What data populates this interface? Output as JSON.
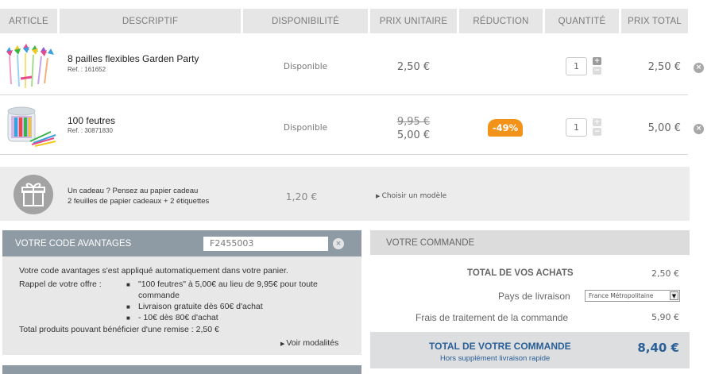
{
  "header": {
    "article": "ARTICLE",
    "descriptif": "DESCRIPTIF",
    "disponibilite": "DISPONIBILITÉ",
    "prix_unitaire": "PRIX UNITAIRE",
    "reduction": "RÉDUCTION",
    "quantite": "QUANTITÉ",
    "prix_total": "PRIX TOTAL"
  },
  "items": [
    {
      "name": "8 pailles flexibles Garden Party",
      "ref": "Ref. : 161652",
      "availability": "Disponible",
      "unit_price": "2,50 €",
      "quantity": "1",
      "total": "2,50 €",
      "thumb_icon": "straws-image"
    },
    {
      "name": "100 feutres",
      "ref": "Ref. : 30871830",
      "availability": "Disponible",
      "old_price": "9,95 €",
      "unit_price": "5,00 €",
      "discount": "-49%",
      "quantity": "1",
      "total": "5,00 €",
      "thumb_icon": "felt-pens-image"
    }
  ],
  "quantity_buttons": {
    "plus": "+",
    "minus": "−"
  },
  "remove_glyph": "×",
  "gift": {
    "icon": "gift-icon",
    "line1": "Un cadeau ? Pensez au papier cadeau",
    "line2": "2 feuilles de papier cadeaux + 2 étiquettes",
    "price": "1,20 €",
    "link": "Choisir un modèle"
  },
  "avantages": {
    "title": "VOTRE CODE AVANTAGES",
    "code": "F2455003",
    "applied": "Votre code avantages s'est appliqué automatiquement dans votre panier.",
    "rappel_label": "Rappel de votre offre :",
    "offers": [
      "\"100 feutres\" à 5,00€ au lieu de 9,95€ pour toute",
      "commande",
      "Livraison gratuite dès 60€ d'achat",
      "- 10€ dès 80€ d'achat"
    ],
    "eligible": "Total produits pouvant bénéficier d'une remise : 2,50 €",
    "voir": "Voir modalités"
  },
  "commande": {
    "title": "VOTRE COMMANDE",
    "achats_label": "TOTAL DE VOS ACHATS",
    "achats_value": "2,50 €",
    "pays_label": "Pays de livraison",
    "pays_value": "France Métropolitaine",
    "frais_label": "Frais de traitement de la commande",
    "frais_value": "5,90 €",
    "total_label": "TOTAL DE VOTRE COMMANDE",
    "total_sub": "Hors supplément livraison rapide",
    "total_value": "8,40 €"
  },
  "colors": {
    "accent_orange": "#f29219",
    "panel_blue_grey": "#8e9aa4",
    "total_blue": "#2a5f98"
  }
}
